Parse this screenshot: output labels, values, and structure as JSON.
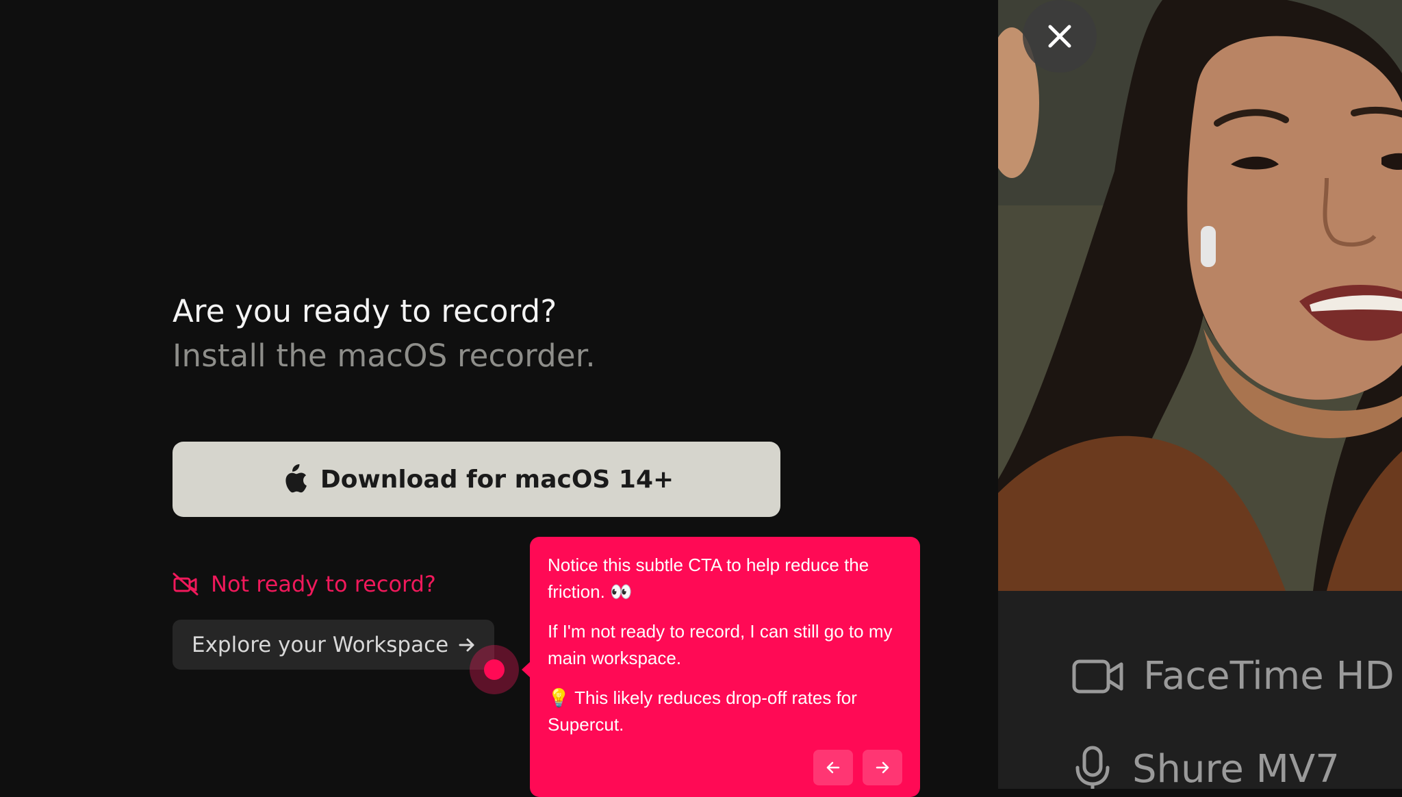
{
  "main": {
    "heading": "Are you ready to record?",
    "subheading": "Install the macOS recorder.",
    "download_label": "Download for macOS 14+",
    "download_icon": "apple-icon",
    "not_ready_label": "Not ready to record?",
    "not_ready_icon": "video-off-icon",
    "explore_label": "Explore your Workspace",
    "explore_icon": "arrow-right-icon"
  },
  "tooltip": {
    "paragraph_1": "Notice this subtle CTA to help reduce the friction. 👀",
    "paragraph_2": "If I'm not ready to record, I can still go to my main workspace.",
    "paragraph_3": "💡 This likely reduces drop-off rates for Supercut.",
    "prev_icon": "arrow-left-icon",
    "next_icon": "arrow-right-icon",
    "color": "#ff0a55"
  },
  "preview": {
    "close_icon": "close-icon",
    "camera_label": "FaceTime HD",
    "camera_icon": "video-camera-icon",
    "microphone_label": "Shure MV7",
    "microphone_icon": "microphone-icon"
  },
  "colors": {
    "accent": "#f0195b",
    "background": "#0f0f0f",
    "button": "#d6d5cd"
  }
}
